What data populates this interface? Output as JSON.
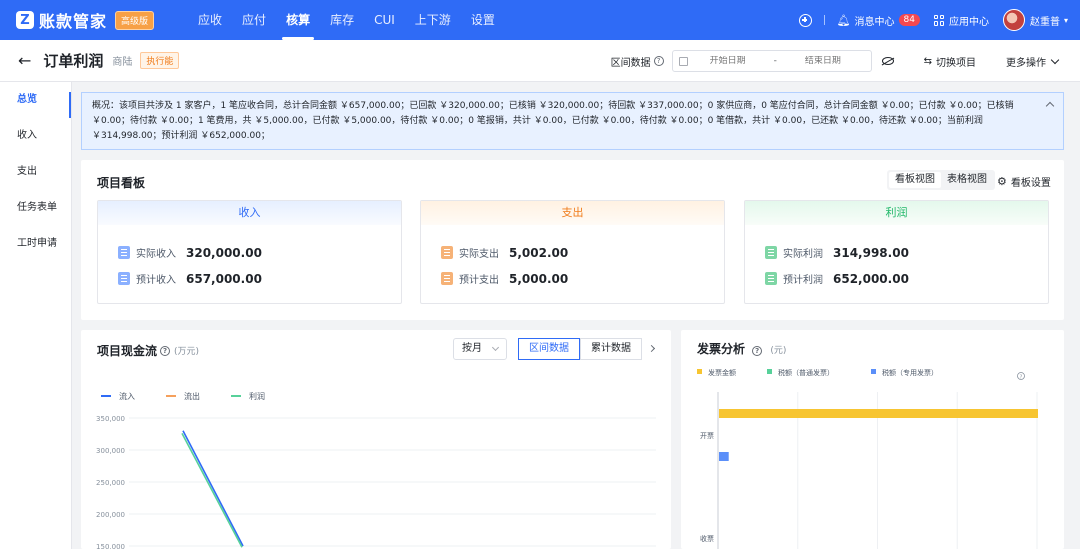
{
  "app": {
    "title": "账款管家",
    "edition": "高级版"
  },
  "nav": {
    "items": [
      "应收",
      "应付",
      "核算",
      "库存",
      "CUI",
      "上下游",
      "设置"
    ],
    "active_index": 2
  },
  "top_right": {
    "messages_label": "消息中心",
    "messages_count": "84",
    "app_center_label": "应用中心",
    "username": "赵重普"
  },
  "header": {
    "title": "订单利润",
    "merchant": "商陆",
    "status": "执行能",
    "range_label": "区间数据",
    "start_placeholder": "开始日期",
    "end_placeholder": "结束日期",
    "range_sep": "-",
    "switch_label": "切换项目",
    "more_label": "更多操作"
  },
  "sidebar": {
    "items": [
      "总览",
      "收入",
      "支出",
      "任务表单",
      "工时申请"
    ],
    "active_index": 0
  },
  "overview": {
    "text": "概况：该项目共涉及 1 家客户，1 笔应收合同，总计合同金额 ￥657,000.00；已回款 ￥320,000.00；已核销 ￥320,000.00；待回款 ￥337,000.00；0 家供应商，0 笔应付合同，总计合同金额 ￥0.00；已付款 ￥0.00；已核销 ￥0.00；待付款 ￥0.00；1 笔费用，共 ￥5,000.00，已付款 ￥5,000.00，待付款 ￥0.00；0 笔报销，共计 ￥0.00，已付款 ￥0.00，待付款 ￥0.00；0 笔借款，共计 ￥0.00，已还款 ￥0.00，待还款 ￥0.00；当前利润 ￥314,998.00；预计利润 ￥652,000.00；"
  },
  "board": {
    "title": "项目看板",
    "view_board": "看板视图",
    "view_table": "表格视图",
    "settings": "看板设置",
    "income": {
      "title": "收入",
      "actual_label": "实际收入",
      "actual_value": "320,000.00",
      "expected_label": "预计收入",
      "expected_value": "657,000.00"
    },
    "expense": {
      "title": "支出",
      "actual_label": "实际支出",
      "actual_value": "5,002.00",
      "expected_label": "预计支出",
      "expected_value": "5,000.00"
    },
    "profit": {
      "title": "利润",
      "actual_label": "实际利润",
      "actual_value": "314,998.00",
      "expected_label": "预计利润",
      "expected_value": "652,000.00"
    }
  },
  "cashflow": {
    "title": "项目现金流",
    "unit": "(万元)",
    "period_select": "按月",
    "tab_range": "区间数据",
    "tab_cumulative": "累计数据"
  },
  "invoice": {
    "title": "发票分析",
    "unit": "(元)"
  },
  "colors": {
    "primary": "#2f6bf6",
    "inflow": "#2f6bf6",
    "outflow": "#f5a05c",
    "profit": "#57d19a",
    "invoice_amount": "#f7c531",
    "tax_normal": "#57d19a",
    "tax_special": "#5b8ff9"
  },
  "chart_data": [
    {
      "type": "line",
      "series": [
        {
          "name": "流入",
          "points": [
            [
              0,
              330000
            ],
            [
              1,
              150000
            ]
          ]
        },
        {
          "name": "流出",
          "points": []
        },
        {
          "name": "利润",
          "points": [
            [
              0,
              326000
            ],
            [
              1,
              148000
            ]
          ]
        }
      ],
      "y_ticks": [
        "350,000",
        "300,000",
        "250,000",
        "200,000",
        "150,000"
      ],
      "ylim": [
        150000,
        350000
      ],
      "legend": "top-left",
      "grid": true
    },
    {
      "type": "bar",
      "orientation": "horizontal",
      "categories": [
        "开票",
        "收票"
      ],
      "series": [
        {
          "name": "发票金额",
          "values": [
            657000,
            0
          ]
        },
        {
          "name": "税额（普通发票）",
          "values": [
            0,
            0
          ]
        },
        {
          "name": "税额（专用发票）",
          "values": [
            20000,
            0
          ]
        }
      ],
      "xlim": [
        0,
        657000
      ],
      "legend": "top-left",
      "grid": true
    }
  ]
}
